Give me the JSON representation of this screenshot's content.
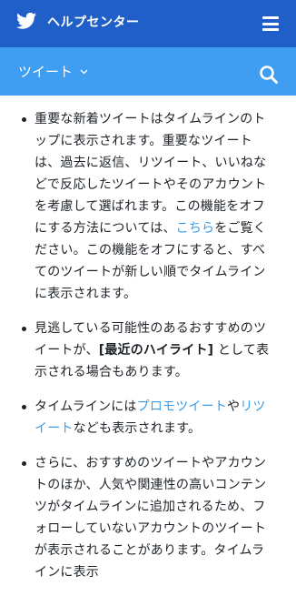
{
  "header": {
    "title": "ヘルプセンター",
    "logo_icon": "twitter-bird-icon",
    "menu_icon": "hamburger-menu-icon",
    "bg_color": "#1f5fc7"
  },
  "subheader": {
    "section": "ツイート",
    "dropdown_icon": "chevron-down-icon",
    "search_icon": "search-icon",
    "bg_color": "#3f9df2"
  },
  "content": {
    "link_color": "#3a9ce8",
    "item1": {
      "text_before": "重要な新着ツイートはタイムラインのトップに表示されます。重要なツイートは、過去に返信、リツイート、いいねなどで反応したツイートやそのアカウントを考慮して選ばれます。この機能をオフにする方法については、",
      "link": "こちら",
      "text_after": "をご覧ください。この機能をオフにすると、すべてのツイートが新しい順でタイムラインに表示されます。"
    },
    "item2": {
      "text_before": "見逃している可能性のあるおすすめのツイートが、",
      "bold": "[最近のハイライト]",
      "text_after": " として表示される場合もあります。"
    },
    "item3": {
      "text_before": "タイムラインには",
      "link1": "プロモツイート",
      "text_mid": "や",
      "link2": "リツイート",
      "text_after": "なども表示されます。"
    },
    "item4": {
      "text": "さらに、おすすめのツイートやアカウントのほか、人気や関連性の高いコンテンツがタイムラインに追加されるため、フォローしていないアカウントのツイートが表示されることがあります。タイムラインに表示"
    }
  }
}
